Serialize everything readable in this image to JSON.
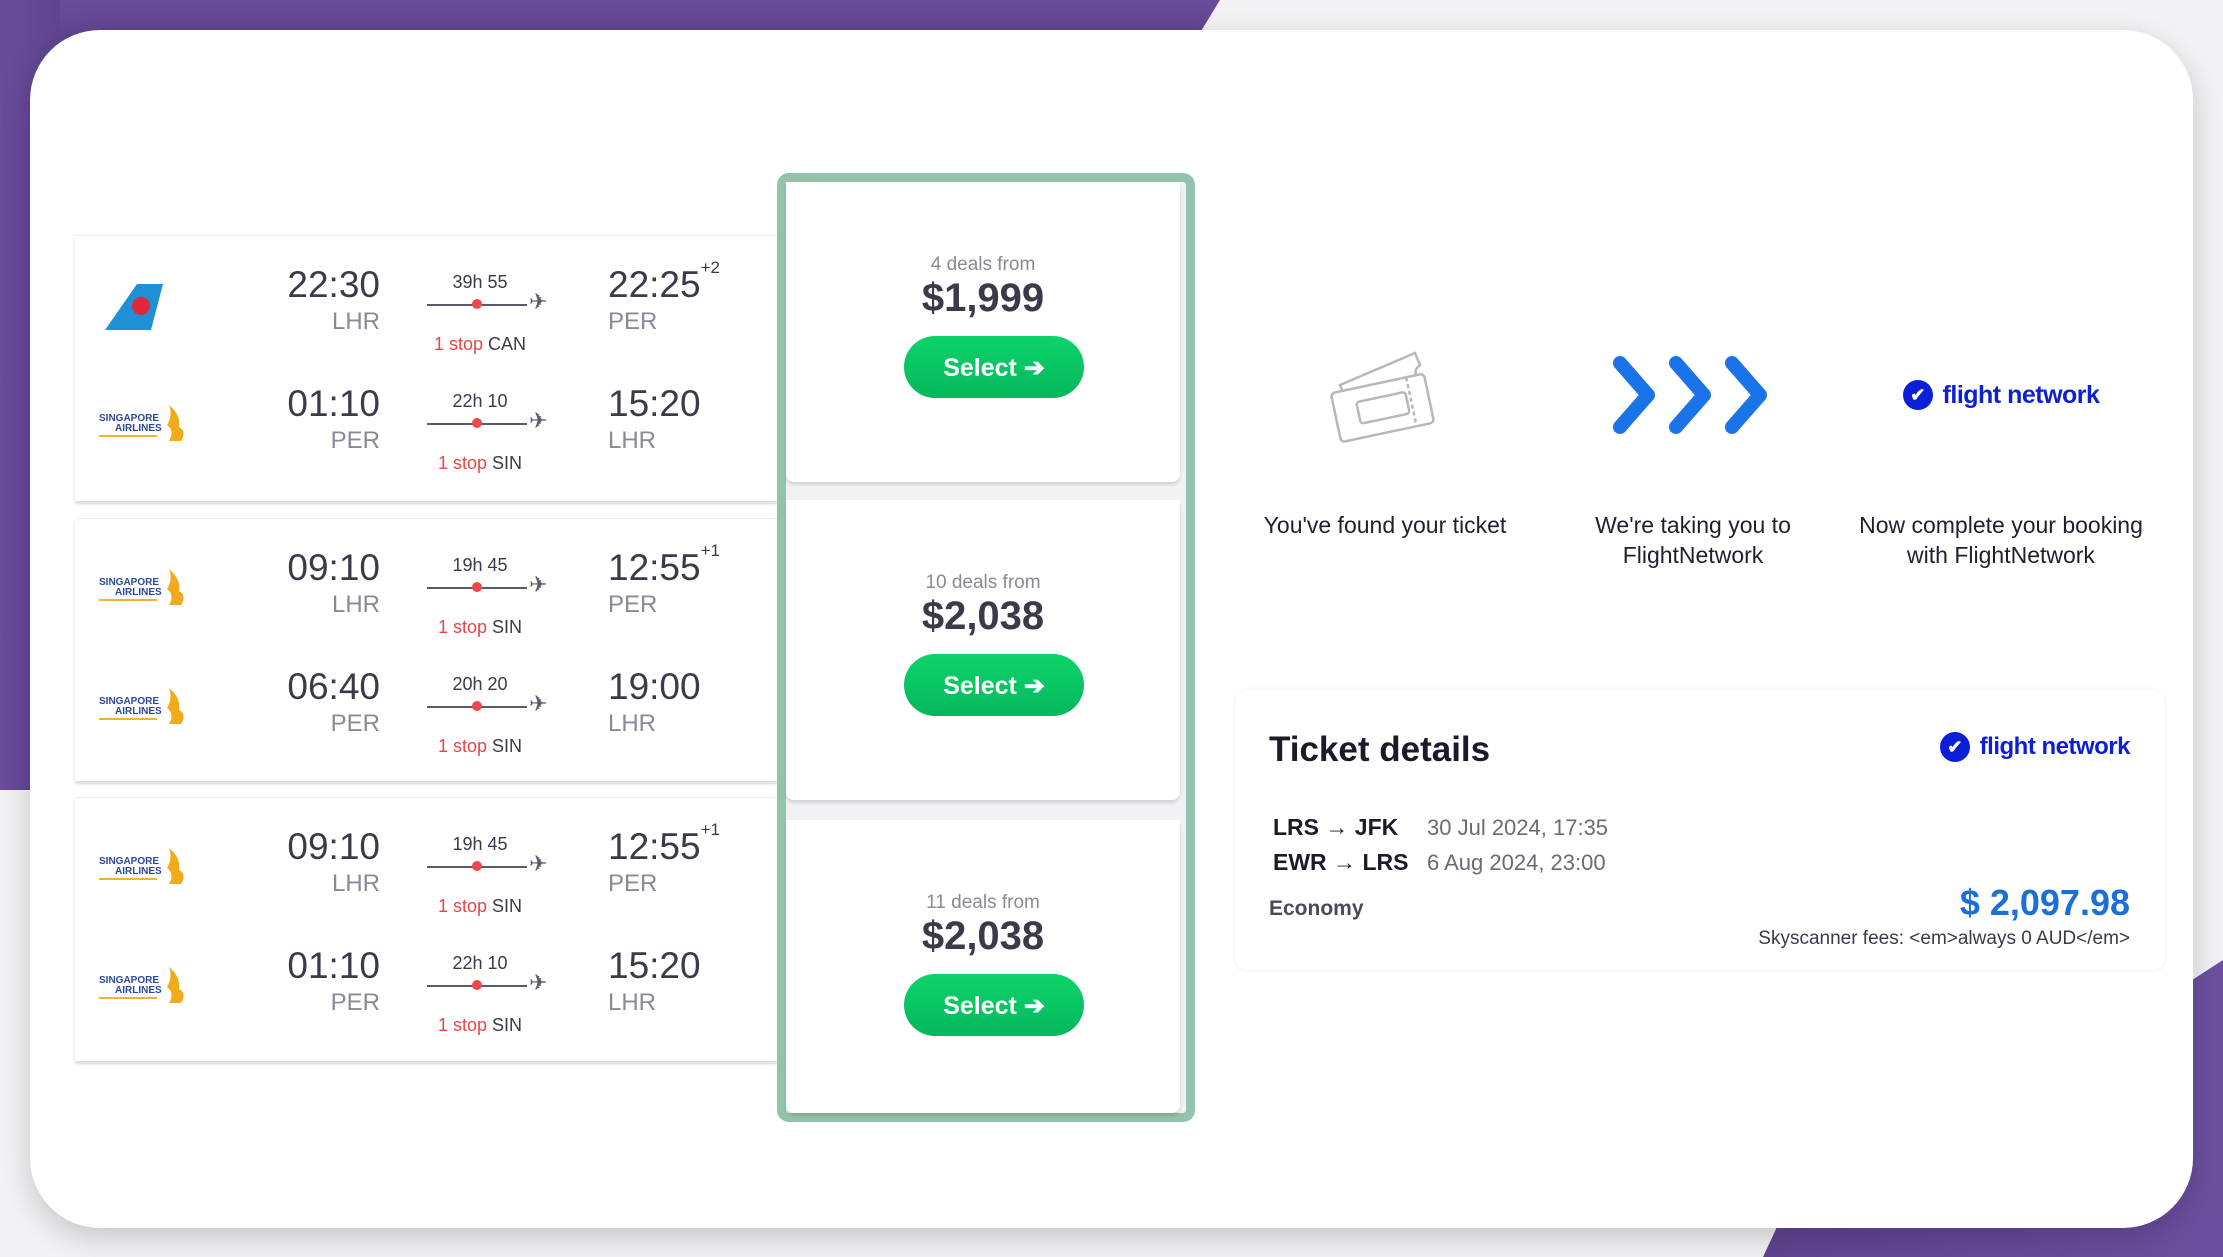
{
  "colors": {
    "accent_green": "#05b85b",
    "frame_green": "#93c3ad",
    "stop_red": "#e84646",
    "brand_blue": "#0a1fd6",
    "price_blue": "#1b6fd8",
    "background_purple": "#6a4c9c"
  },
  "itineraries": [
    {
      "legs": [
        {
          "airline": "China Southern Airlines",
          "logo_icon": "china-southern-logo-icon",
          "depart_time": "22:30",
          "depart_airport": "LHR",
          "duration": "39h 55",
          "stops_label": "1 stop",
          "stop_airport": "CAN",
          "arrive_time": "22:25",
          "day_offset": "+2",
          "arrive_airport": "PER"
        },
        {
          "airline": "Singapore Airlines",
          "logo_icon": "singapore-airlines-logo-icon",
          "depart_time": "01:10",
          "depart_airport": "PER",
          "duration": "22h 10",
          "stops_label": "1 stop",
          "stop_airport": "SIN",
          "arrive_time": "15:20",
          "day_offset": "",
          "arrive_airport": "LHR"
        }
      ],
      "deals": "4 deals from",
      "price": "$1,999",
      "select_label": "Select"
    },
    {
      "legs": [
        {
          "airline": "Singapore Airlines",
          "logo_icon": "singapore-airlines-logo-icon",
          "depart_time": "09:10",
          "depart_airport": "LHR",
          "duration": "19h 45",
          "stops_label": "1 stop",
          "stop_airport": "SIN",
          "arrive_time": "12:55",
          "day_offset": "+1",
          "arrive_airport": "PER"
        },
        {
          "airline": "Singapore Airlines",
          "logo_icon": "singapore-airlines-logo-icon",
          "depart_time": "06:40",
          "depart_airport": "PER",
          "duration": "20h 20",
          "stops_label": "1 stop",
          "stop_airport": "SIN",
          "arrive_time": "19:00",
          "day_offset": "",
          "arrive_airport": "LHR"
        }
      ],
      "deals": "10 deals from",
      "price": "$2,038",
      "select_label": "Select"
    },
    {
      "legs": [
        {
          "airline": "Singapore Airlines",
          "logo_icon": "singapore-airlines-logo-icon",
          "depart_time": "09:10",
          "depart_airport": "LHR",
          "duration": "19h 45",
          "stops_label": "1 stop",
          "stop_airport": "SIN",
          "arrive_time": "12:55",
          "day_offset": "+1",
          "arrive_airport": "PER"
        },
        {
          "airline": "Singapore Airlines",
          "logo_icon": "singapore-airlines-logo-icon",
          "depart_time": "01:10",
          "depart_airport": "PER",
          "duration": "22h 10",
          "stops_label": "1 stop",
          "stop_airport": "SIN",
          "arrive_time": "15:20",
          "day_offset": "",
          "arrive_airport": "LHR"
        }
      ],
      "deals": "11 deals from",
      "price": "$2,038",
      "select_label": "Select"
    }
  ],
  "steps": [
    {
      "icon": "ticket-icon",
      "text": "You've found your ticket"
    },
    {
      "icon": "triple-chevron-icon",
      "text": "We're taking you to FlightNetwork"
    },
    {
      "icon": "flight-network-logo-icon",
      "text": "Now complete your booking with FlightNetwork"
    }
  ],
  "brand": {
    "name": "flight network"
  },
  "ticket": {
    "title": "Ticket details",
    "routes": [
      {
        "route": "LRS → JFK",
        "date": "30 Jul 2024, 17:35"
      },
      {
        "route": "EWR → LRS",
        "date": "6 Aug 2024, 23:00"
      }
    ],
    "cabin": "Economy",
    "total": "$ 2,097.98",
    "fees": "Skyscanner fees: <em>always 0 AUD</em>"
  }
}
